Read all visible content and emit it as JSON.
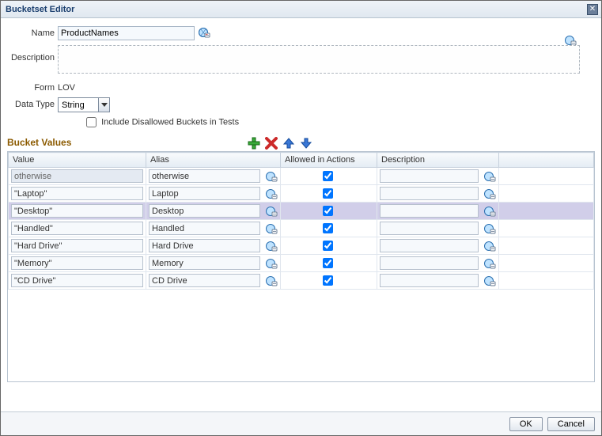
{
  "window": {
    "title": "Bucketset Editor",
    "close_glyph": "✕"
  },
  "form": {
    "name_label": "Name",
    "name_value": "ProductNames",
    "description_label": "Description",
    "description_value": "",
    "form_label": "Form",
    "form_value": "LOV",
    "datatype_label": "Data Type",
    "datatype_value": "String",
    "include_disallowed_label": "Include Disallowed Buckets in Tests",
    "include_disallowed_checked": false
  },
  "bucket_values": {
    "heading": "Bucket Values",
    "columns": {
      "value": "Value",
      "alias": "Alias",
      "allowed": "Allowed in Actions",
      "description": "Description"
    },
    "rows": [
      {
        "value": "otherwise",
        "value_editable": false,
        "alias": "otherwise",
        "allowed": true,
        "description": "",
        "selected": false
      },
      {
        "value": "\"Laptop\"",
        "value_editable": true,
        "alias": "Laptop",
        "allowed": true,
        "description": "",
        "selected": false
      },
      {
        "value": "\"Desktop\"",
        "value_editable": true,
        "alias": "Desktop",
        "allowed": true,
        "description": "",
        "selected": true
      },
      {
        "value": "\"Handled\"",
        "value_editable": true,
        "alias": "Handled",
        "allowed": true,
        "description": "",
        "selected": false
      },
      {
        "value": "\"Hard Drive\"",
        "value_editable": true,
        "alias": "Hard Drive",
        "allowed": true,
        "description": "",
        "selected": false
      },
      {
        "value": "\"Memory\"",
        "value_editable": true,
        "alias": "Memory",
        "allowed": true,
        "description": "",
        "selected": false
      },
      {
        "value": "\"CD Drive\"",
        "value_editable": true,
        "alias": "CD Drive",
        "allowed": true,
        "description": "",
        "selected": false
      }
    ]
  },
  "footer": {
    "ok": "OK",
    "cancel": "Cancel"
  }
}
